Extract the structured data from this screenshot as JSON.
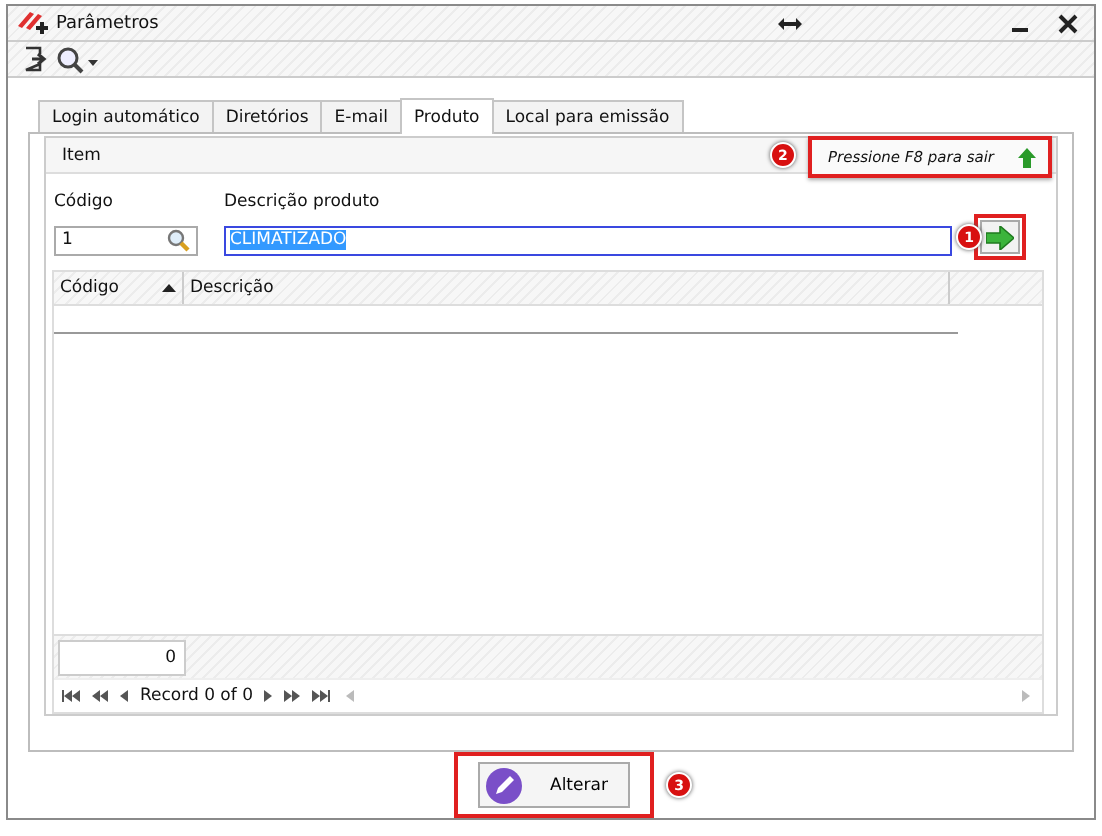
{
  "window": {
    "title": "Parâmetros"
  },
  "tabs": [
    {
      "label": "Login automático",
      "selected": false
    },
    {
      "label": "Diretórios",
      "selected": false
    },
    {
      "label": "E-mail",
      "selected": false
    },
    {
      "label": "Produto",
      "selected": true
    },
    {
      "label": "Local para emissão",
      "selected": false
    }
  ],
  "group": {
    "title": "Item",
    "hint": "Pressione F8 para sair"
  },
  "fields": {
    "code": {
      "label": "Código",
      "value": "1"
    },
    "description": {
      "label": "Descrição produto",
      "value": "CLIMATIZADO"
    }
  },
  "grid": {
    "columns": [
      {
        "label": "Código",
        "sorted": true
      },
      {
        "label": "Descrição",
        "sorted": false
      }
    ],
    "footer_count": "0",
    "navigator": "Record 0 of 0"
  },
  "button": {
    "label": "Alterar"
  },
  "callouts": [
    "1",
    "2",
    "3"
  ]
}
